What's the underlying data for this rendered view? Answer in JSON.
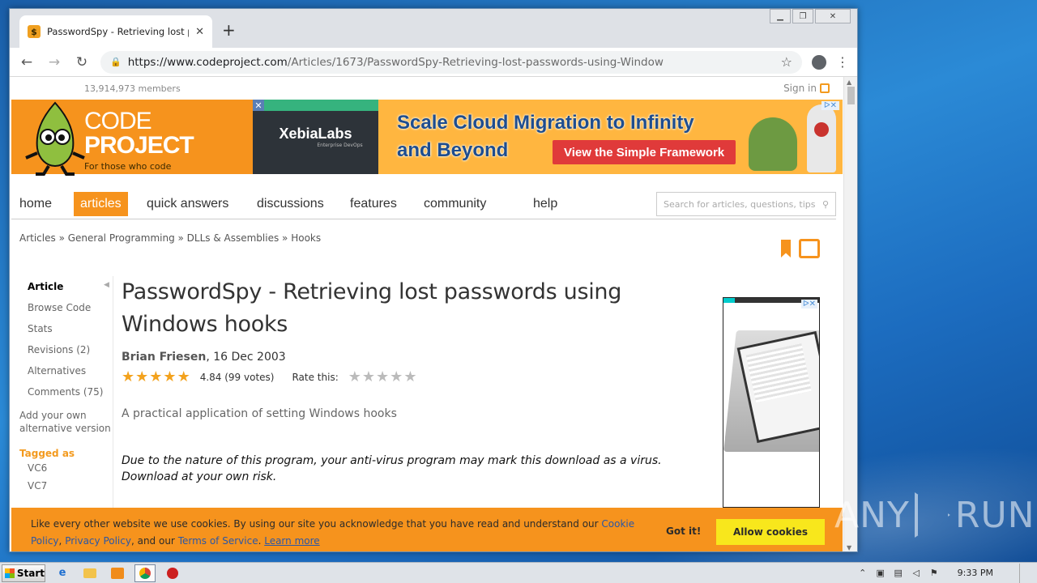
{
  "browser": {
    "tab_title": "PasswordSpy - Retrieving lost passw",
    "url_host": "https://www.codeproject.com",
    "url_path": "/Articles/1673/PasswordSpy-Retrieving-lost-passwords-using-Window",
    "new_tab": "+",
    "close_tab": "✕"
  },
  "header": {
    "members": "13,914,973 members",
    "sign_in": "Sign in"
  },
  "logo": {
    "line1": "CODE",
    "line2": "PROJECT",
    "tagline": "For those who code"
  },
  "ad": {
    "brand": "XebiaLabs",
    "brand_sub": "Enterprise DevOps",
    "headline_1": "Scale Cloud Migration to Infinity",
    "headline_2": "and Beyond",
    "cta": "View the Simple Framework"
  },
  "nav": {
    "items": [
      "home",
      "articles",
      "quick answers",
      "discussions",
      "features",
      "community",
      "help"
    ],
    "active": "articles",
    "search_placeholder": "Search for articles, questions, tips"
  },
  "breadcrumb": "Articles » General Programming » DLLs & Assemblies » Hooks",
  "sidebar": {
    "links": [
      "Article",
      "Browse Code",
      "Stats",
      "Revisions (2)",
      "Alternatives",
      "Comments (75)"
    ],
    "add_alt": "Add your own alternative version",
    "tagged_as": "Tagged as",
    "tags": [
      "VC6",
      "VC7"
    ]
  },
  "article": {
    "title": "PasswordSpy - Retrieving lost passwords using Windows hooks",
    "author": "Brian Friesen",
    "date": ", 16 Dec 2003",
    "rating_value": 4.84,
    "rating_text": "4.84 (99 votes)",
    "rate_this": "Rate this:",
    "summary": "A practical application of setting Windows hooks",
    "warning": "Due to the nature of this program, your anti-virus program may mark this download as a virus. Download at your own risk."
  },
  "cookie": {
    "text_1": "Like every other website we use cookies. By using our site you acknowledge that you have read and understand our ",
    "cookie_policy": "Cookie Policy",
    "comma": ",",
    "privacy_policy": "Privacy Policy",
    "text_2": ", and our ",
    "terms": "Terms of Service",
    "text_3": ". ",
    "learn_more": "Learn more",
    "got_it": "Got it!",
    "allow": "Allow cookies"
  },
  "taskbar": {
    "start": "Start",
    "clock": "9:33 PM"
  },
  "watermark": "ANY RUN",
  "colors": {
    "brand_orange": "#f6931d",
    "desktop_blue": "#1f6fb8",
    "allow_yellow": "#f8e71c"
  }
}
